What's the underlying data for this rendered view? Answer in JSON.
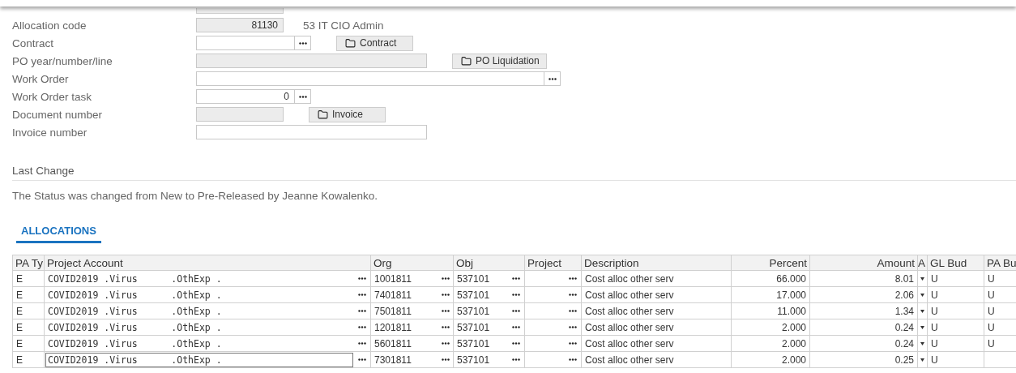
{
  "form": {
    "fields": [
      {
        "label": "Allocation code",
        "kind": "code",
        "value": "81130",
        "note": "53 IT CIO Admin"
      },
      {
        "label": "Contract",
        "kind": "lookup",
        "button": "Contract"
      },
      {
        "label": "PO year/number/line",
        "kind": "display",
        "button": "PO Liquidation"
      },
      {
        "label": "Work Order",
        "kind": "search"
      },
      {
        "label": "Work Order task",
        "kind": "lookup",
        "value": "0"
      },
      {
        "label": "Document number",
        "kind": "code",
        "button": "Invoice"
      },
      {
        "label": "Invoice number",
        "kind": "entry"
      }
    ]
  },
  "last_change": {
    "title": "Last Change",
    "message": "The Status was changed from New to Pre-Released by Jeanne Kowalenko."
  },
  "tabs": [
    {
      "label": "ALLOCATIONS",
      "selected": true
    }
  ],
  "table": {
    "columns": [
      "PA Ty",
      "Project Account",
      "Org",
      "Obj",
      "Project",
      "Description",
      "Percent",
      "Amount",
      "A",
      "GL Bud",
      "PA Bu"
    ],
    "rows": [
      {
        "pa_type": "E",
        "project_account": "COVID2019 .Virus      .OthExp .",
        "org": "1001811",
        "obj": "537101",
        "description": "Cost alloc other serv",
        "percent": "66.000",
        "amount": "8.01",
        "gl_bud": "U",
        "pa_bud": "U",
        "selected": false
      },
      {
        "pa_type": "E",
        "project_account": "COVID2019 .Virus      .OthExp .",
        "org": "7401811",
        "obj": "537101",
        "description": "Cost alloc other serv",
        "percent": "17.000",
        "amount": "2.06",
        "gl_bud": "U",
        "pa_bud": "U",
        "selected": false
      },
      {
        "pa_type": "E",
        "project_account": "COVID2019 .Virus      .OthExp .",
        "org": "7501811",
        "obj": "537101",
        "description": "Cost alloc other serv",
        "percent": "11.000",
        "amount": "1.34",
        "gl_bud": "U",
        "pa_bud": "U",
        "selected": false
      },
      {
        "pa_type": "E",
        "project_account": "COVID2019 .Virus      .OthExp .",
        "org": "1201811",
        "obj": "537101",
        "description": "Cost alloc other serv",
        "percent": "2.000",
        "amount": "0.24",
        "gl_bud": "U",
        "pa_bud": "U",
        "selected": false
      },
      {
        "pa_type": "E",
        "project_account": "COVID2019 .Virus      .OthExp .",
        "org": "5601811",
        "obj": "537101",
        "description": "Cost alloc other serv",
        "percent": "2.000",
        "amount": "0.24",
        "gl_bud": "U",
        "pa_bud": "U",
        "selected": false
      },
      {
        "pa_type": "E",
        "project_account": "COVID2019 .Virus      .OthExp .",
        "org": "7301811",
        "obj": "537101",
        "description": "Cost alloc other serv",
        "percent": "2.000",
        "amount": "0.25",
        "gl_bud": "U",
        "selected": true
      }
    ]
  }
}
